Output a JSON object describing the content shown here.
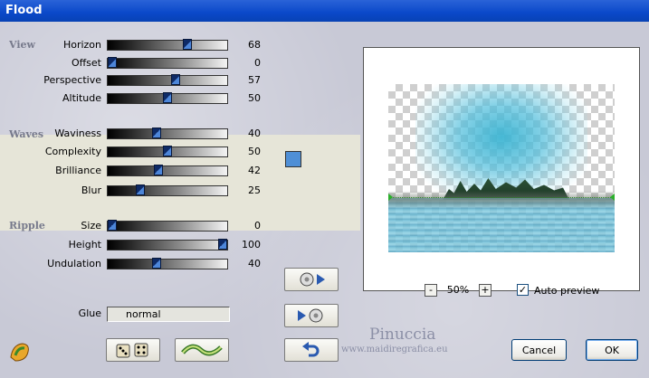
{
  "window": {
    "title": "Flood"
  },
  "sections": {
    "view": "View",
    "waves": "Waves",
    "ripple": "Ripple"
  },
  "params": {
    "horizon": {
      "label": "Horizon",
      "value": "68",
      "fraction": 0.68
    },
    "offset": {
      "label": "Offset",
      "value": "0",
      "fraction": 0.0
    },
    "perspective": {
      "label": "Perspective",
      "value": "57",
      "fraction": 0.57
    },
    "altitude": {
      "label": "Altitude",
      "value": "50",
      "fraction": 0.5
    },
    "waviness": {
      "label": "Waviness",
      "value": "40",
      "fraction": 0.4
    },
    "complexity": {
      "label": "Complexity",
      "value": "50",
      "fraction": 0.5
    },
    "brilliance": {
      "label": "Brilliance",
      "value": "42",
      "fraction": 0.42
    },
    "blur": {
      "label": "Blur",
      "value": "25",
      "fraction": 0.25
    },
    "size": {
      "label": "Size",
      "value": "0",
      "fraction": 0.0
    },
    "height": {
      "label": "Height",
      "value": "100",
      "fraction": 1.0
    },
    "undulation": {
      "label": "Undulation",
      "value": "40",
      "fraction": 0.4
    }
  },
  "wave_color": "#4f8fd6",
  "glue": {
    "label": "Glue",
    "value": "normal"
  },
  "zoom": {
    "minus": "-",
    "level": "50%",
    "plus": "+"
  },
  "auto_preview": {
    "label": "Auto preview",
    "checked": true,
    "mark": "✓"
  },
  "buttons": {
    "cancel": "Cancel",
    "ok": "OK"
  },
  "icons": {
    "plugin": "plugin-logo-icon",
    "randomize": "dice-icon",
    "wave": "wave-icon",
    "save_preset": "save-preset-icon",
    "load_preset": "load-preset-icon",
    "reset": "undo-icon"
  },
  "watermark": {
    "name": "Pinuccia",
    "url": "www.maidiregrafica.eu"
  }
}
